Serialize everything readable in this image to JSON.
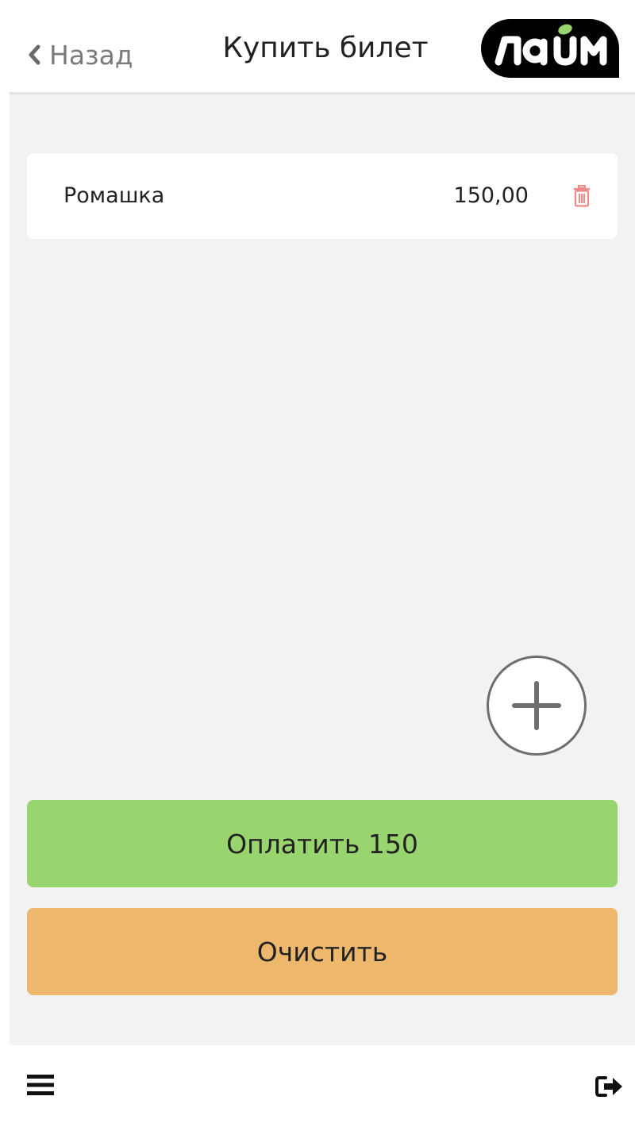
{
  "header": {
    "back_label": "Назад",
    "title": "Купить билет",
    "logo_text": "лайм",
    "logo_colors": {
      "background": "#000000",
      "text": "#ffffff",
      "accent": "#98d56f"
    }
  },
  "cart": {
    "items": [
      {
        "name": "Ромашка",
        "price": "150,00"
      }
    ]
  },
  "actions": {
    "pay_label": "Оплатить 150",
    "clear_label": "Очистить"
  },
  "icons": {
    "back": "chevron-left-icon",
    "delete": "trash-icon",
    "add": "plus-icon",
    "menu": "hamburger-menu-icon",
    "logout": "logout-icon"
  },
  "colors": {
    "pay_button": "#98d56f",
    "clear_button": "#eeb86c",
    "delete_icon": "#f08a8a",
    "content_background": "#f2f2f2"
  }
}
